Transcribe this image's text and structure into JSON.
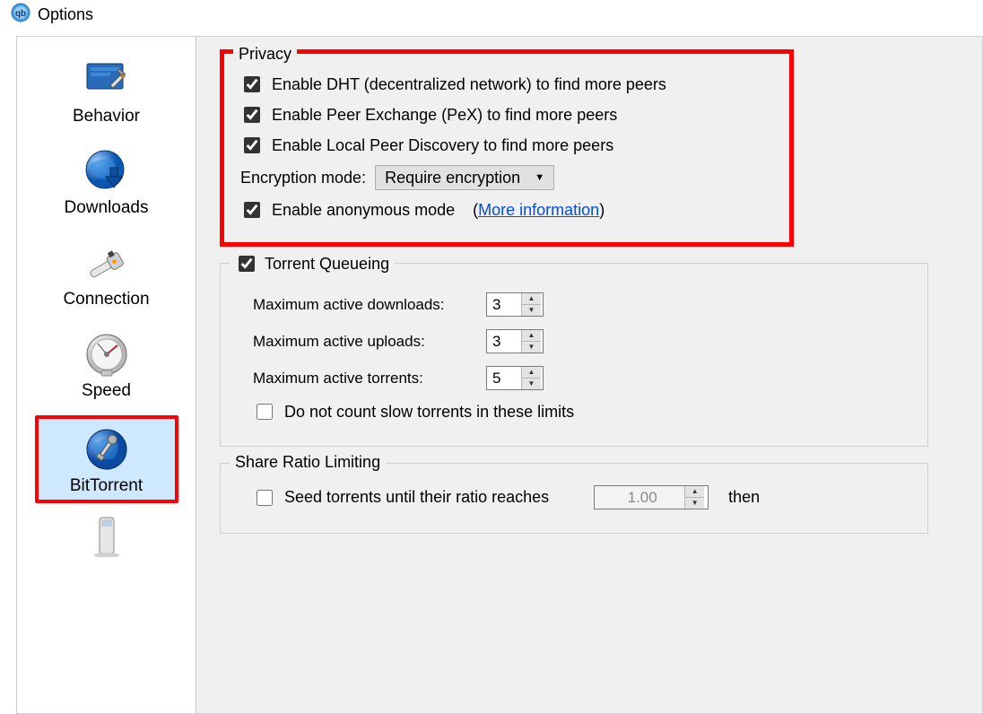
{
  "window": {
    "title": "Options"
  },
  "sidebar": {
    "items": [
      {
        "label": "Behavior"
      },
      {
        "label": "Downloads"
      },
      {
        "label": "Connection"
      },
      {
        "label": "Speed"
      },
      {
        "label": "BitTorrent"
      }
    ]
  },
  "privacy": {
    "title": "Privacy",
    "dht_label": "Enable DHT (decentralized network) to find more peers",
    "pex_label": "Enable Peer Exchange (PeX) to find more peers",
    "lpd_label": "Enable Local Peer Discovery to find more peers",
    "enc_label": "Encryption mode:",
    "enc_value": "Require encryption",
    "anon_label": "Enable anonymous mode",
    "more_info": "More information"
  },
  "queue": {
    "title": "Torrent Queueing",
    "max_dl_label": "Maximum active downloads:",
    "max_dl_value": "3",
    "max_ul_label": "Maximum active uploads:",
    "max_ul_value": "3",
    "max_t_label": "Maximum active torrents:",
    "max_t_value": "5",
    "slow_label": "Do not count slow torrents in these limits"
  },
  "ratio": {
    "title": "Share Ratio Limiting",
    "seed_label": "Seed torrents until their ratio reaches",
    "seed_value": "1.00",
    "then_label": "then"
  }
}
